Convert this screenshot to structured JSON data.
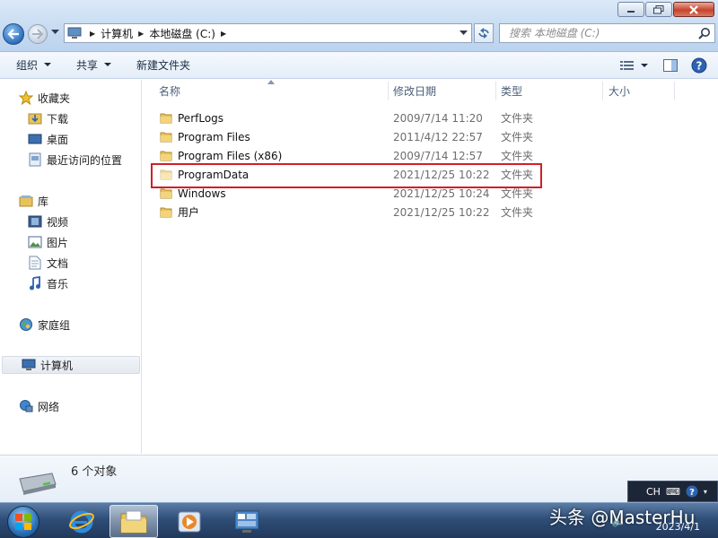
{
  "address": {
    "crumbs": [
      "计算机",
      "本地磁盘 (C:)"
    ]
  },
  "search": {
    "placeholder": "搜索 本地磁盘 (C:)"
  },
  "toolbar": {
    "organize": "组织",
    "share": "共享",
    "new_folder": "新建文件夹"
  },
  "nav": {
    "favorites": "收藏夹",
    "downloads": "下载",
    "desktop": "桌面",
    "recent": "最近访问的位置",
    "libraries": "库",
    "videos": "视频",
    "pictures": "图片",
    "documents": "文档",
    "music": "音乐",
    "homegroup": "家庭组",
    "computer": "计算机",
    "network": "网络"
  },
  "columns": {
    "name": "名称",
    "date": "修改日期",
    "type": "类型",
    "size": "大小"
  },
  "files": [
    {
      "name": "PerfLogs",
      "date": "2009/7/14 11:20",
      "type": "文件夹"
    },
    {
      "name": "Program Files",
      "date": "2011/4/12 22:57",
      "type": "文件夹"
    },
    {
      "name": "Program Files (x86)",
      "date": "2009/7/14 12:57",
      "type": "文件夹"
    },
    {
      "name": "ProgramData",
      "date": "2021/12/25 10:22",
      "type": "文件夹"
    },
    {
      "name": "Windows",
      "date": "2021/12/25 10:24",
      "type": "文件夹"
    },
    {
      "name": "用户",
      "date": "2021/12/25 10:22",
      "type": "文件夹"
    }
  ],
  "details": {
    "count": "6 个对象"
  },
  "tray": {
    "lang": "CH",
    "date": "2023/4/1"
  },
  "watermark": "头条 @MasterHu",
  "colors": {
    "highlight": "#cf2026",
    "folder": "#e8c35a"
  }
}
